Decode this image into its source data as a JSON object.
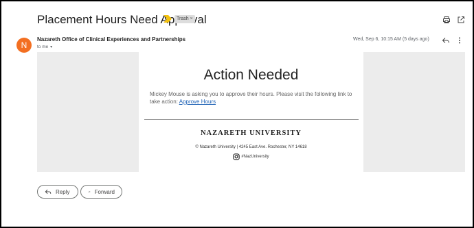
{
  "email": {
    "subject": "Placement Hours Need Approval",
    "label": "Trash",
    "label_remove": "×",
    "avatar_letter": "N",
    "sender": "Nazareth Office of Clinical Experiences and Partnerships",
    "recipient": "to me",
    "recipient_caret": "▾",
    "date": "Wed, Sep 6, 10:15 AM (5 days ago)"
  },
  "body": {
    "headline": "Action Needed",
    "message_text": "Mickey Mouse is asking you to approve their hours. Please visit the following link to take action: ",
    "link_text": "Approve Hours",
    "university": "NAZARETH UNIVERSITY",
    "address": "© Nazareth University | 4245 East Ave. Rochester, NY 14618",
    "social_handle": "#NazUniversity"
  },
  "actions": {
    "reply_label": "Reply",
    "forward_label": "Forward"
  },
  "colors": {
    "avatar": "#f36f21",
    "important_marker": "#f4c20d",
    "link": "#1a5fb4",
    "placeholder_gray": "#ececec"
  },
  "icons": [
    "important-marker-icon",
    "printer-icon",
    "open-in-new-window-icon",
    "reply-icon",
    "more-vertical-icon",
    "instagram-icon",
    "forward-icon"
  ]
}
